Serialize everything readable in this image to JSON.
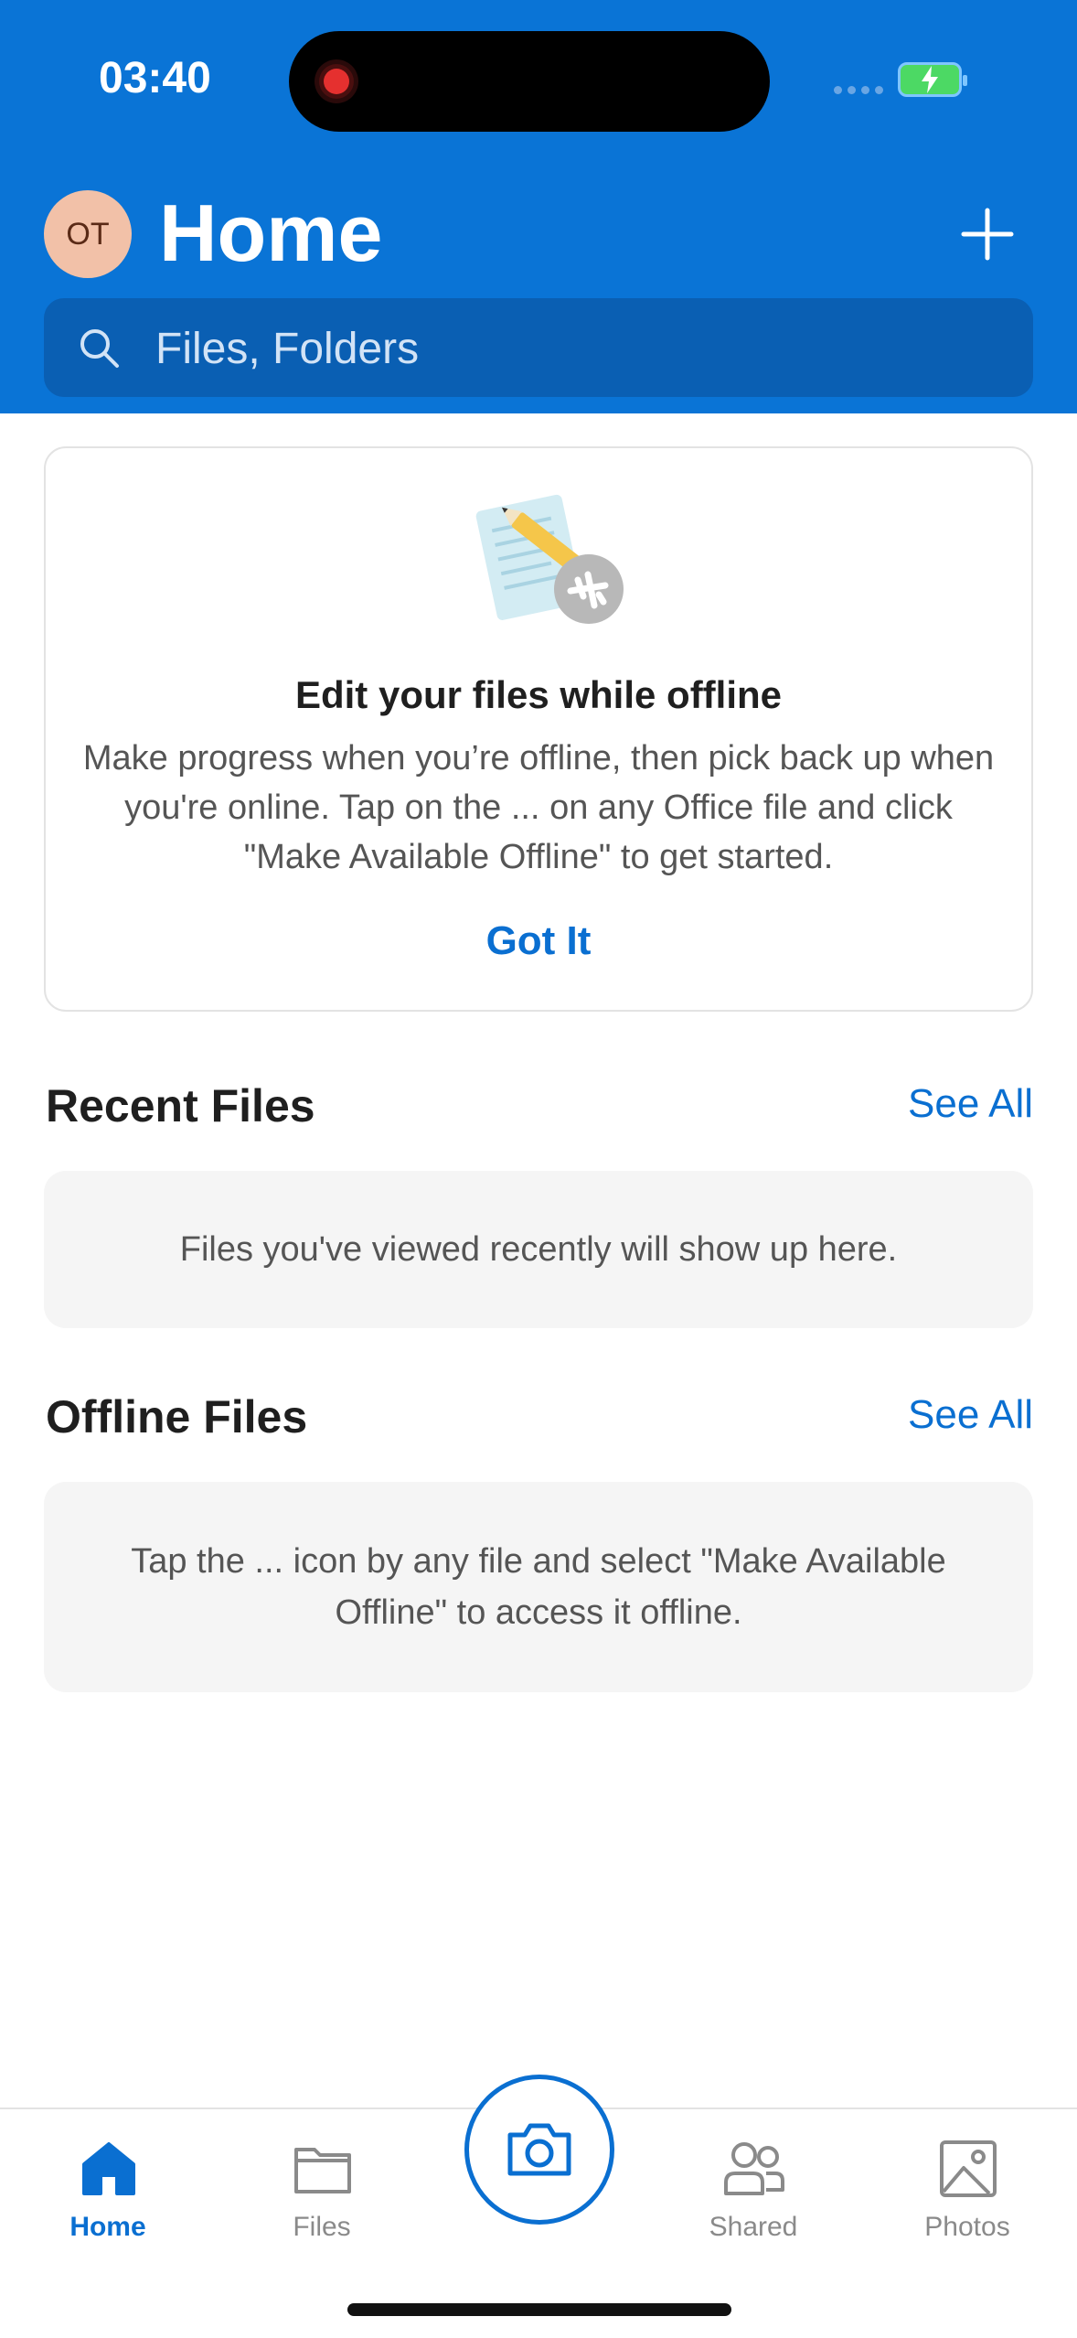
{
  "status_bar": {
    "time": "03:40"
  },
  "header": {
    "avatar_initials": "OT",
    "title": "Home",
    "search_placeholder": "Files, Folders",
    "accent_color": "#0a74d6"
  },
  "offline_card": {
    "title": "Edit your files while offline",
    "body": "Make progress when you’re offline, then pick back up when you're online. Tap on the ... on any Office file and click \"Make Available Offline\" to get started.",
    "button": "Got It"
  },
  "recent_files": {
    "title": "Recent Files",
    "see_all": "See All",
    "empty_message": "Files you've viewed recently will show up here."
  },
  "offline_files": {
    "title": "Offline Files",
    "see_all": "See All",
    "empty_message": "Tap the ... icon by any file and select \"Make Available Offline\" to access it offline."
  },
  "tabs": [
    {
      "label": "Home",
      "icon": "home-icon",
      "active": true
    },
    {
      "label": "Files",
      "icon": "folder-icon",
      "active": false
    },
    {
      "label": "Shared",
      "icon": "people-icon",
      "active": false
    },
    {
      "label": "Photos",
      "icon": "photo-icon",
      "active": false
    }
  ],
  "camera": {
    "icon": "camera-icon"
  }
}
